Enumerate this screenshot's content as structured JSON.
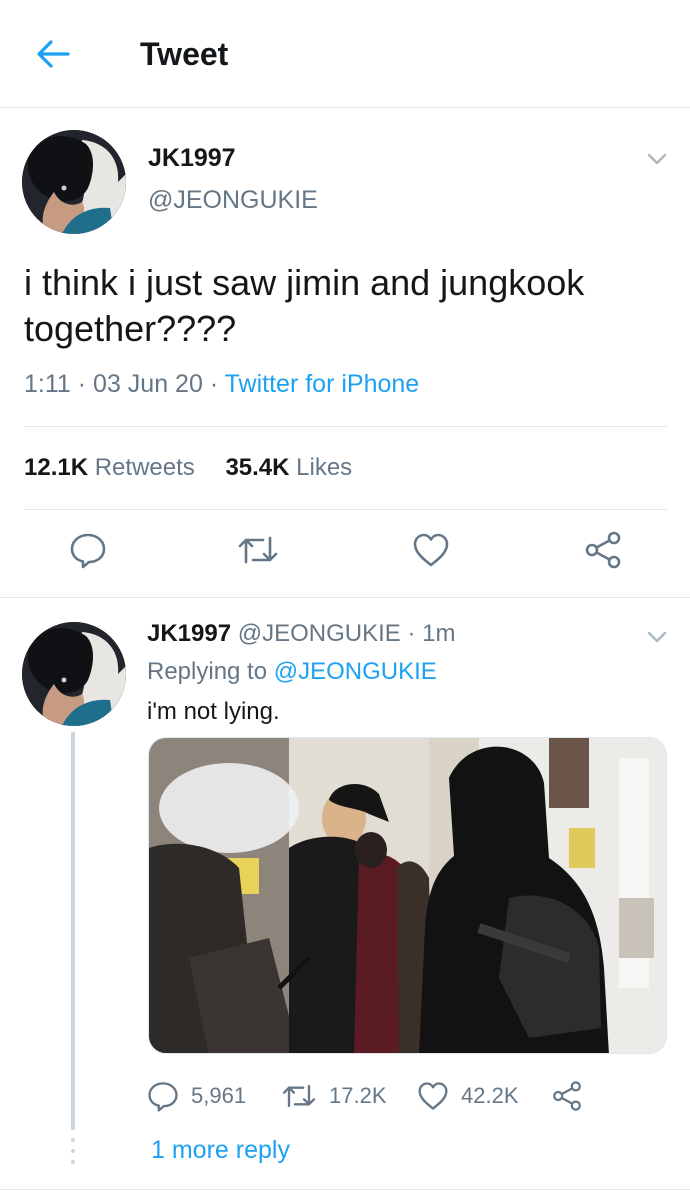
{
  "header": {
    "title": "Tweet",
    "back_icon": "arrow-left-icon"
  },
  "colors": {
    "accent": "#1da1f2",
    "text": "#14171a",
    "secondary": "#657786",
    "border": "#e1e8ed"
  },
  "tweet": {
    "author_name": "JK1997",
    "author_handle": "@JEONGUKIE",
    "text": "i think i just saw jimin and jungkook together????",
    "time": "1:11",
    "date": "03 Jun 20",
    "source": "Twitter for iPhone",
    "retweets_count": "12.1K",
    "retweets_label": "Retweets",
    "likes_count": "35.4K",
    "likes_label": "Likes"
  },
  "reply": {
    "author_name": "JK1997",
    "author_handle": "@JEONGUKIE",
    "time_ago": "1m",
    "replying_prefix": "Replying to",
    "replying_to": "@JEONGUKIE",
    "text": "i'm not lying.",
    "replies_count": "5,961",
    "retweets_count": "17.2K",
    "likes_count": "42.2K",
    "more_replies": "1 more reply"
  }
}
